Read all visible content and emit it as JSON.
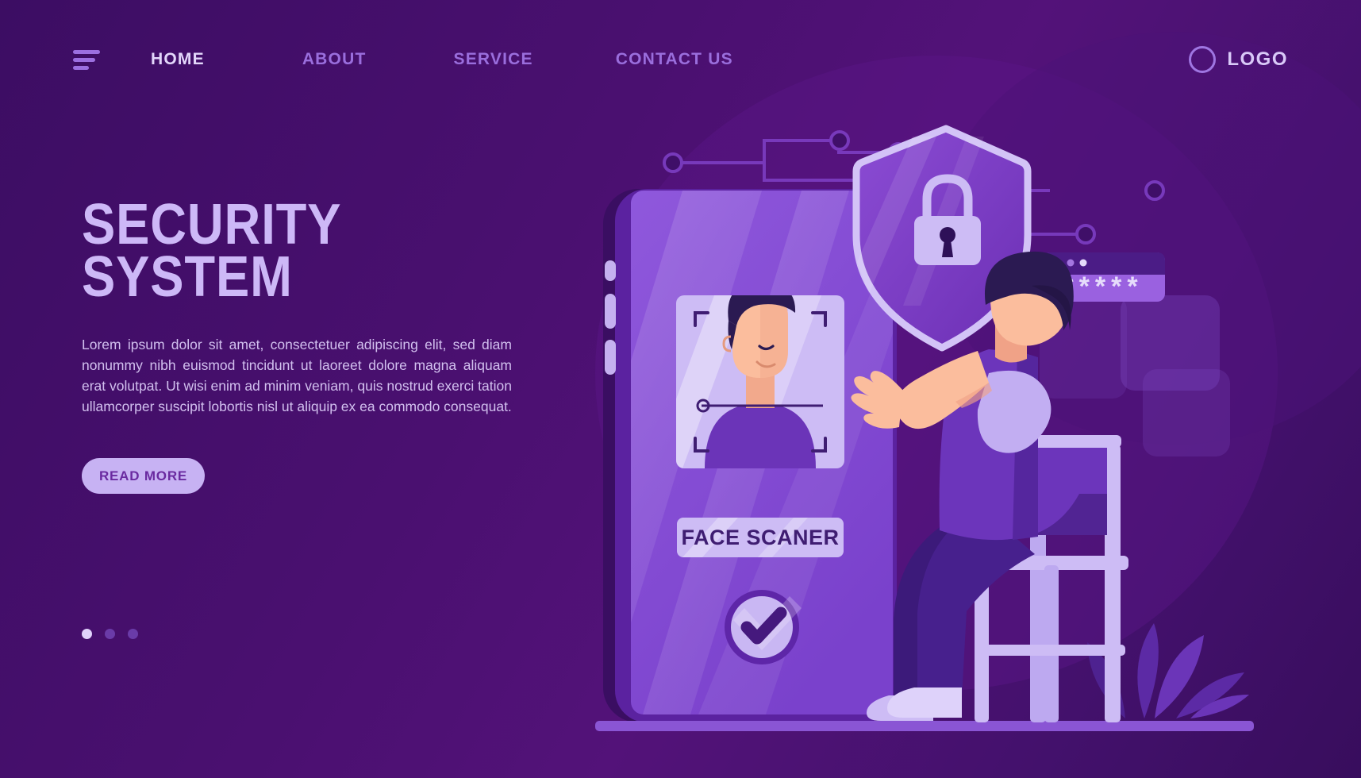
{
  "nav": {
    "menu_icon": "hamburger-menu-icon",
    "links": [
      {
        "label": "HOME",
        "active": true
      },
      {
        "label": "ABOUT",
        "active": false
      },
      {
        "label": "SERVICE",
        "active": false
      },
      {
        "label": "CONTACT US",
        "active": false
      }
    ],
    "logo": {
      "icon": "circle-logo-icon",
      "text": "LOGO"
    }
  },
  "hero": {
    "title": "SECURITY\nSYSTEM",
    "body": "Lorem ipsum dolor sit amet, consectetuer adipiscing elit, sed diam nonummy nibh euismod tincidunt ut laoreet dolore magna aliquam erat volutpat. Ut wisi enim ad minim veniam, quis nostrud exerci tation ullamcorper suscipit lobortis nisl ut aliquip ex ea commodo consequat.",
    "cta_label": "READ MORE",
    "carousel": {
      "total": 3,
      "active_index": 0
    }
  },
  "illustration": {
    "phone": {
      "face_scanner_label": "FACE SCANER",
      "scan_frame_icon": "face-scan-bracket-icon",
      "confirm_icon": "checkmark-circle-icon"
    },
    "shield": {
      "icon": "shield-lock-icon"
    },
    "password_window": {
      "masked_value": "*****",
      "window_dots": 3
    },
    "person": {
      "icon": "seated-person-icon"
    },
    "plant": {
      "icon": "leaf-plant-icon"
    },
    "circuit": {
      "icon": "circuit-lines-icon"
    }
  },
  "colors": {
    "background_dark": "#3c0d63",
    "background_mid": "#4a1070",
    "accent_lavender": "#c7b2f3",
    "accent_purple": "#7b3fc4",
    "text_light": "#d2c0ef",
    "title_color": "#cdb8f7",
    "nav_inactive": "#9a6edd",
    "nav_active": "#e3d7fb",
    "skin": "#f8b193",
    "hair_dark": "#2b1a52",
    "phone_screen": "#8a52d6"
  }
}
